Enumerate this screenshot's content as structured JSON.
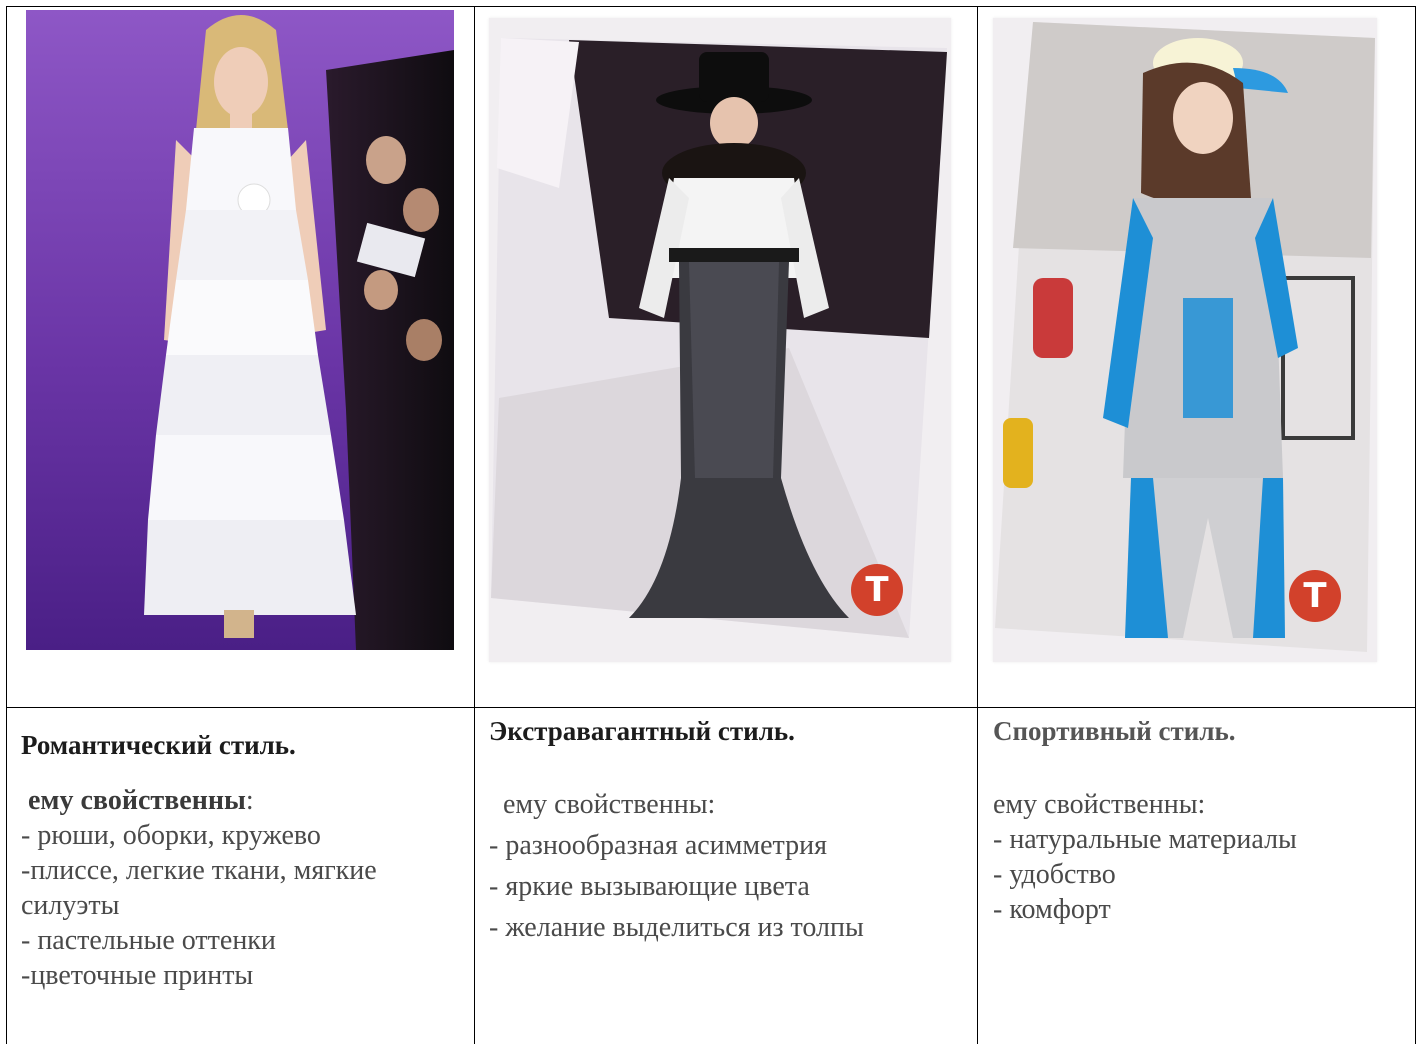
{
  "columns": [
    {
      "image": {
        "alt": "Романтический стиль",
        "accent": "#6b3fa0"
      },
      "title": "Романтический стиль.",
      "intro_bold": "ему свойственны",
      "intro_rest": ":",
      "items": [
        "- рюши, оборки, кружево",
        "-плиссе, легкие ткани, мягкие",
        "силуэты",
        "- пастельные оттенки",
        "-цветочные принты"
      ]
    },
    {
      "image": {
        "alt": "Экстравагантный стиль",
        "accent": "#2b2b2b"
      },
      "title": "Экстравагантный стиль.",
      "intro": "ему свойственны:",
      "items": [
        "- разнообразная асимметрия",
        "- яркие вызывающие цвета",
        "- желание выделиться из толпы"
      ],
      "logo_letter": "T"
    },
    {
      "image": {
        "alt": "Спортивный стиль",
        "accent": "#1e8fd6"
      },
      "title": "Спортивный стиль.",
      "intro": "ему свойственны:",
      "items": [
        "- натуральные материалы",
        "- удобство",
        "- комфорт"
      ],
      "logo_letter": "T"
    }
  ]
}
